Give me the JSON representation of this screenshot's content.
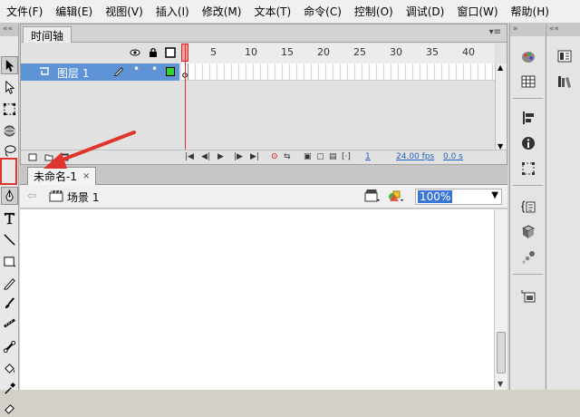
{
  "menu": [
    "文件(F)",
    "编辑(E)",
    "视图(V)",
    "插入(I)",
    "修改(M)",
    "文本(T)",
    "命令(C)",
    "控制(O)",
    "调试(D)",
    "窗口(W)",
    "帮助(H)"
  ],
  "timeline": {
    "tab_label": "时间轴",
    "panel_menu": "▾≡",
    "ruler_numbers": [
      "1",
      "5",
      "10",
      "15",
      "20",
      "25",
      "30",
      "35",
      "40"
    ],
    "layer_name": "图层 1",
    "footer": {
      "current_frame": "1",
      "frame_rate": "24.00 fps",
      "elapsed_time": "0.0 s"
    }
  },
  "document": {
    "tab_label": "未命名-1",
    "tab_close": "×",
    "scene_label": "场景 1",
    "zoom": "100%",
    "zoom_arrow": "▼"
  },
  "colors": {
    "highlight": "#e0352d",
    "layer_selected": "#5e93d6",
    "playhead": "#e03030",
    "zoom_selection": "#3875d7"
  }
}
